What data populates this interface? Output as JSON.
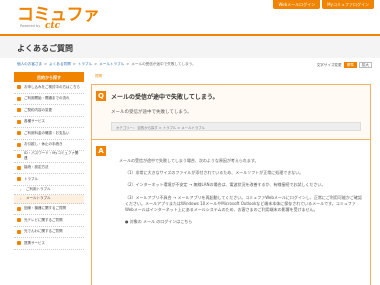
{
  "header": {
    "logo_main": "コミュファ",
    "logo_sub": "Powered by",
    "logo_brand": "ctc",
    "top_links": [
      "Webメールログイン",
      "Myコミュファログイン"
    ]
  },
  "page_title": "よくあるご質問",
  "breadcrumb": [
    "個人のお客さま",
    "よくある質問",
    "トラブル",
    "メールトラブル",
    "メールの受信が途中で失敗してしまう。"
  ],
  "font_size": {
    "label": "文字サイズ変更",
    "options": [
      "標準",
      "拡大"
    ]
  },
  "sidebar": {
    "head": "目的から探す",
    "items": [
      {
        "label": "お申し込みをご検討中の方はこちら",
        "kind": "main"
      },
      {
        "label": "ご利用開始・開通までの流れ",
        "kind": "main"
      },
      {
        "label": "ご契約内容の変更",
        "kind": "main"
      },
      {
        "label": "各種サービス",
        "kind": "main"
      },
      {
        "label": "ご利用料金の確認・お支払い",
        "kind": "main"
      },
      {
        "label": "お引越し・休止の手続き",
        "kind": "main"
      },
      {
        "label": "ID・パスワード・Myコミュファ関連",
        "kind": "main"
      },
      {
        "label": "接続・設定方法",
        "kind": "main"
      },
      {
        "label": "トラブル",
        "kind": "main"
      },
      {
        "label": "ご利用トラブル",
        "kind": "sub"
      },
      {
        "label": "メールトラブル",
        "kind": "sub"
      },
      {
        "label": "回線・機器に関するご質問",
        "kind": "main"
      },
      {
        "label": "光テレビに関するご質問",
        "kind": "main"
      },
      {
        "label": "光でんわに関するご質問",
        "kind": "main"
      },
      {
        "label": "提携サービス",
        "kind": "main"
      }
    ]
  },
  "question": {
    "small_label": "質問",
    "mark": "Q",
    "title": "メールの受信が途中で失敗してしまう。",
    "text": "メールの受信が途中で失敗してしまう。",
    "category": "カテゴリー：  目的から探す > トラブル > メールトラブル"
  },
  "answer": {
    "mark": "A",
    "intro": "メールの受信が途中で失敗してしまう場合、次のような原因が考えられます。",
    "items": [
      "（1）非常に大きなサイズのファイルが添付されているため、メールソフトが正常に処理できない。",
      "（2）インターネット環境が不安定 → 無線LANの場合は、電波状況を改善するか、有線接続でお試しください。",
      "（3）メールアプリ不具合 → メールアプリを再起動してください。コミュファWebメールにログインし、正常にご利用可能かご確認ください。メールアプリまたはWindows 10メールやMicrosoft Outlookなど端末本体に保存されているメールです。コミュファWebメールはインターネット上にあるメールシステムのため、お客さまのご利用端末の影響を受けません。",
      "● 対象の メール のログインはこちら"
    ]
  }
}
